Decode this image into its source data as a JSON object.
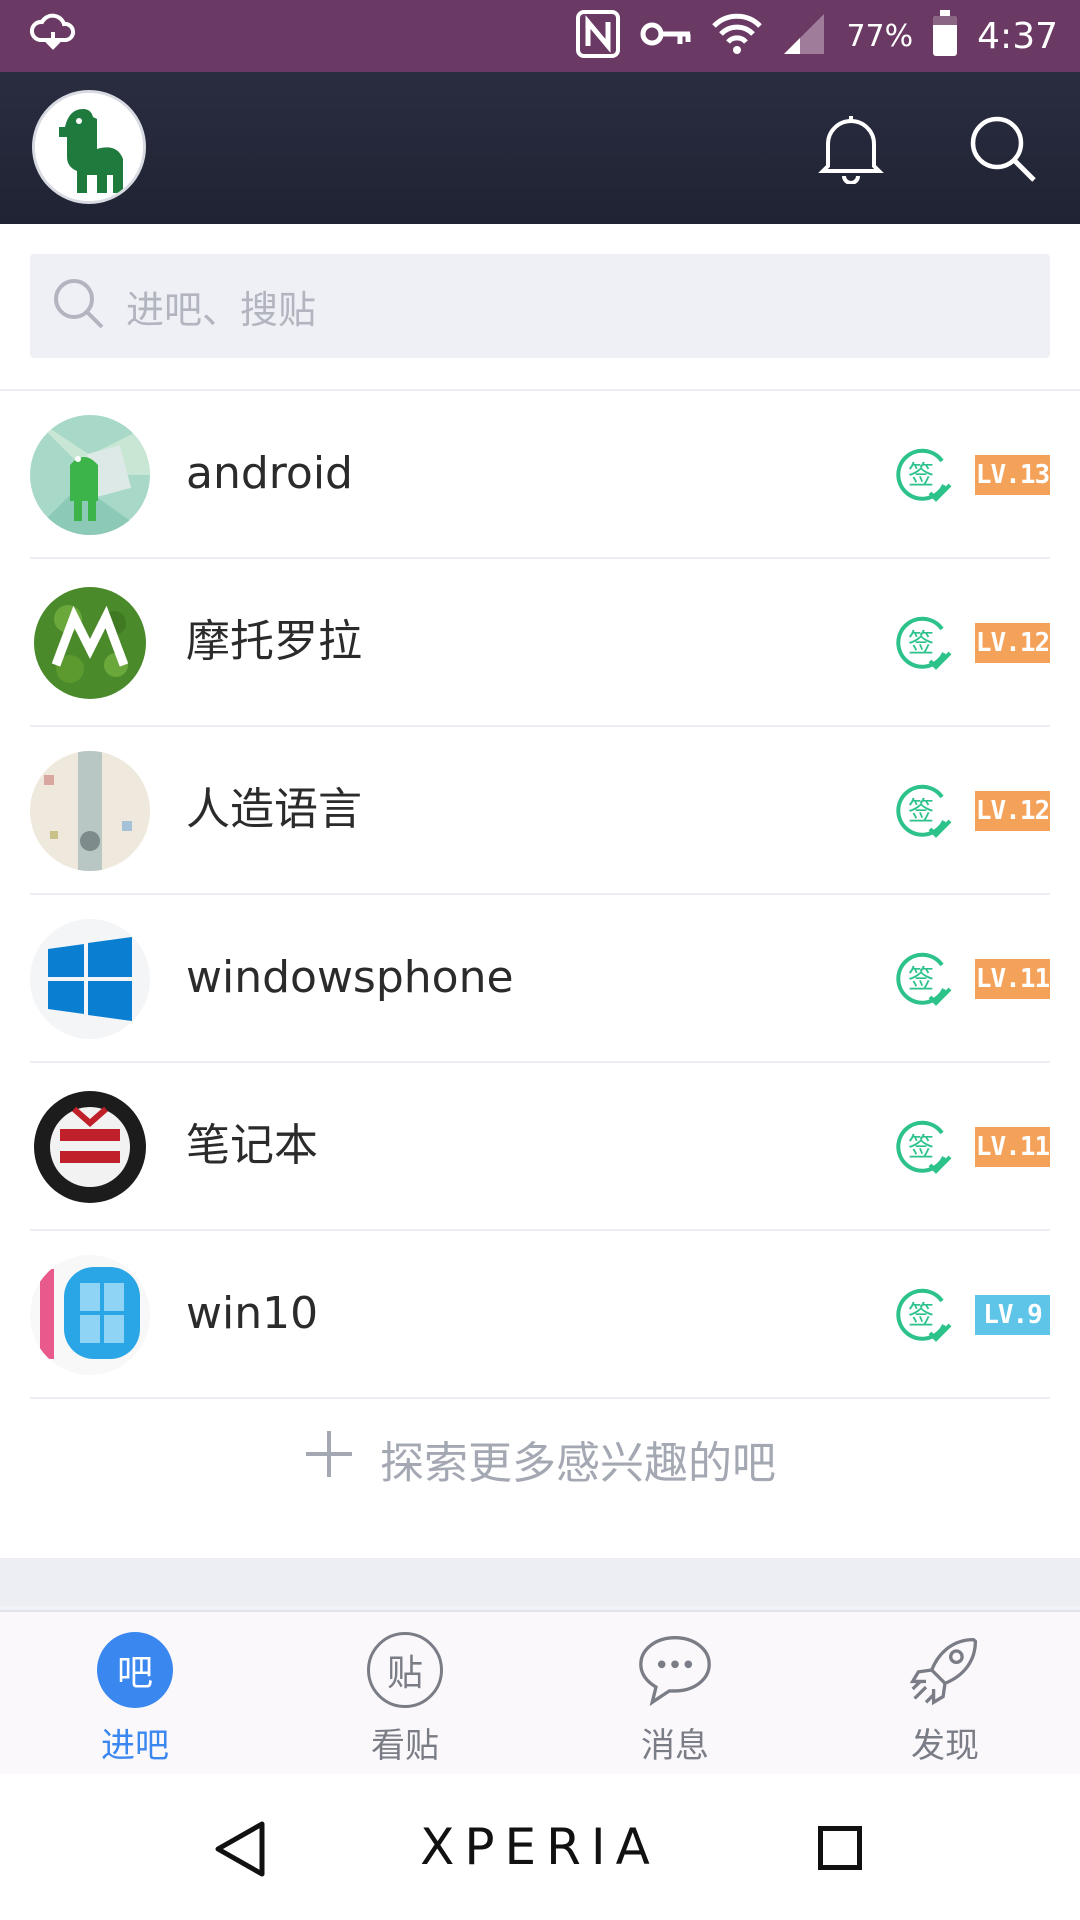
{
  "status_bar": {
    "battery": "77%",
    "time": "4:37"
  },
  "header": {},
  "search": {
    "placeholder": "进吧、搜贴"
  },
  "forums": [
    {
      "name": "android",
      "level": "LV.13",
      "level_color": "#f4a25a"
    },
    {
      "name": "摩托罗拉",
      "level": "LV.12",
      "level_color": "#f4a25a"
    },
    {
      "name": "人造语言",
      "level": "LV.12",
      "level_color": "#f4a25a"
    },
    {
      "name": "windowsphone",
      "level": "LV.11",
      "level_color": "#f4a25a"
    },
    {
      "name": "笔记本",
      "level": "LV.11",
      "level_color": "#f4a25a"
    },
    {
      "name": "win10",
      "level": "LV.9",
      "level_color": "#5ec5e8"
    }
  ],
  "sign_in_label": "签",
  "explore": {
    "label": "探索更多感兴趣的吧"
  },
  "tabs": [
    {
      "icon_char": "吧",
      "label": "进吧",
      "active": true
    },
    {
      "icon_char": "贴",
      "label": "看贴",
      "active": false
    },
    {
      "icon_char": "···",
      "label": "消息",
      "active": false
    },
    {
      "icon_char": "",
      "label": "发现",
      "active": false
    }
  ],
  "nav": {
    "brand": "XPERIA"
  },
  "colors": {
    "status_bar": "#6b3a64",
    "header": "#23273a",
    "accent": "#3a87f0",
    "sign_green": "#2cc28a"
  }
}
